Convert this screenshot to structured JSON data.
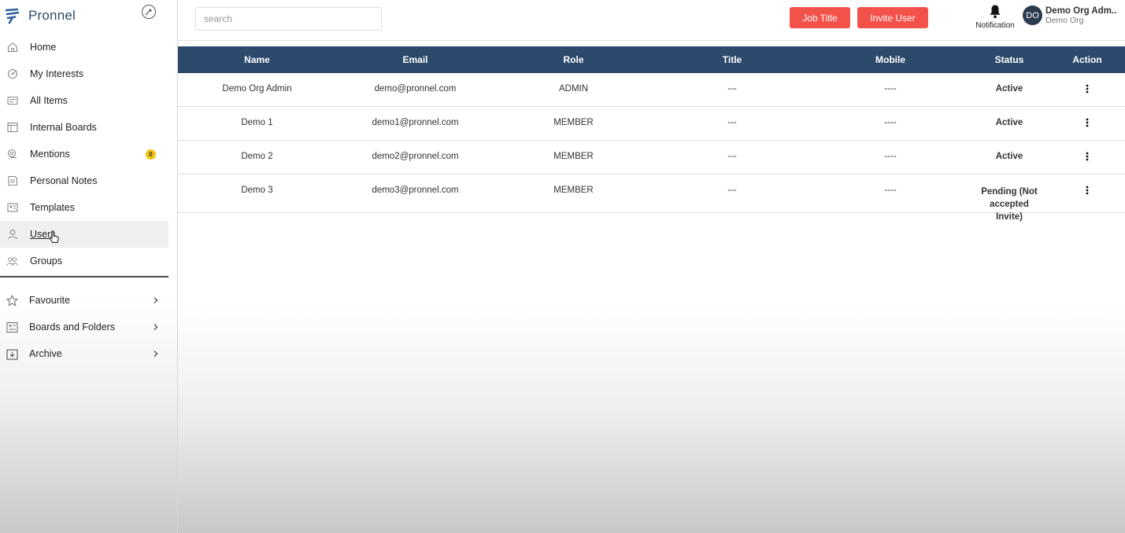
{
  "brand": {
    "name": "Pronnel"
  },
  "sidebar": {
    "items": [
      {
        "label": "Home",
        "icon": "home-icon"
      },
      {
        "label": "My Interests",
        "icon": "interests-icon"
      },
      {
        "label": "All Items",
        "icon": "all-items-icon"
      },
      {
        "label": "Internal Boards",
        "icon": "internal-boards-icon"
      },
      {
        "label": "Mentions",
        "icon": "mentions-icon",
        "badge": "0"
      },
      {
        "label": "Personal Notes",
        "icon": "notes-icon"
      },
      {
        "label": "Templates",
        "icon": "templates-icon"
      },
      {
        "label": "Users",
        "icon": "user-icon",
        "active": true
      },
      {
        "label": "Groups",
        "icon": "groups-icon"
      }
    ],
    "sections": [
      {
        "label": "Favourite",
        "icon": "star-icon"
      },
      {
        "label": "Boards and Folders",
        "icon": "boards-folders-icon"
      },
      {
        "label": "Archive",
        "icon": "archive-icon"
      }
    ]
  },
  "topbar": {
    "search_placeholder": "search",
    "job_title_label": "Job Title",
    "invite_user_label": "Invite User",
    "notification_label": "Notification",
    "user": {
      "initials": "DO",
      "name": "Demo Org Adm..",
      "org": "Demo Org"
    }
  },
  "colors": {
    "accent": "#f2524a",
    "header": "#2c4a6b",
    "badge": "#f3c316",
    "avatar": "#2c3a4e"
  },
  "table": {
    "headers": {
      "name": "Name",
      "email": "Email",
      "role": "Role",
      "title": "Title",
      "mobile": "Mobile",
      "status": "Status",
      "action": "Action"
    },
    "rows": [
      {
        "name": "Demo Org Admin",
        "email": "demo@pronnel.com",
        "role": "ADMIN",
        "title": "---",
        "mobile": "----",
        "status": "Active"
      },
      {
        "name": "Demo 1",
        "email": "demo1@pronnel.com",
        "role": "MEMBER",
        "title": "---",
        "mobile": "----",
        "status": "Active"
      },
      {
        "name": "Demo 2",
        "email": "demo2@pronnel.com",
        "role": "MEMBER",
        "title": "---",
        "mobile": "----",
        "status": "Active"
      },
      {
        "name": "Demo 3",
        "email": "demo3@pronnel.com",
        "role": "MEMBER",
        "title": "---",
        "mobile": "----",
        "status": "Pending (Not accepted Invite)"
      }
    ]
  }
}
